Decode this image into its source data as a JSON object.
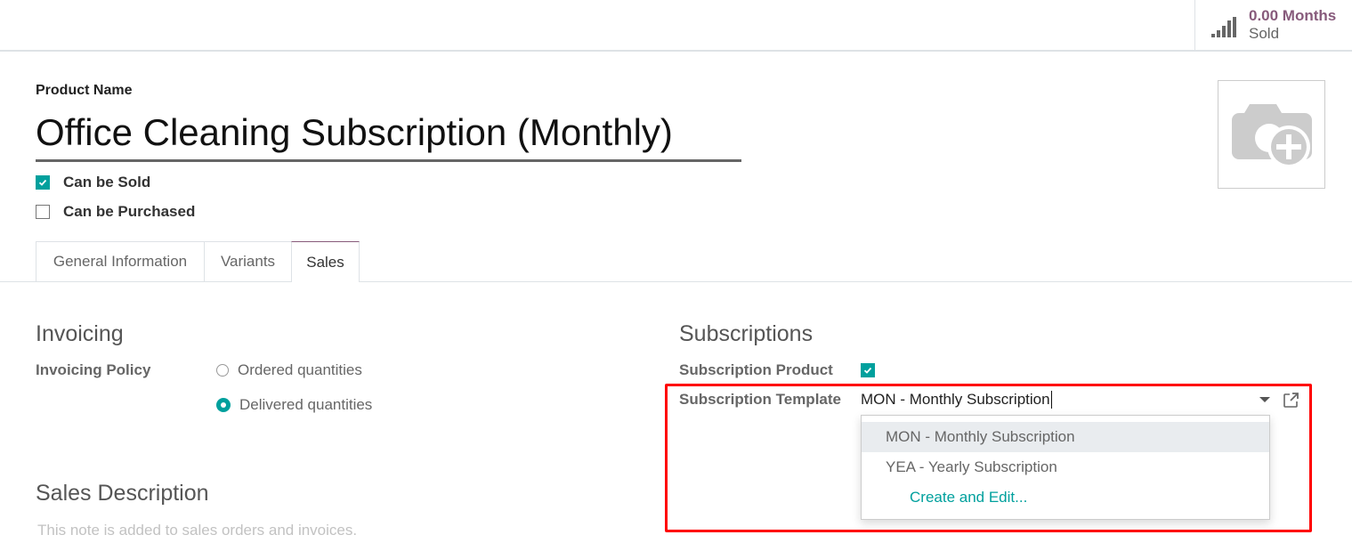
{
  "smart_button": {
    "value": "0.00 Months",
    "label": "Sold",
    "icon": "signal-bars-icon"
  },
  "product": {
    "name_label": "Product Name",
    "name": "Office Cleaning Subscription (Monthly)",
    "can_be_sold": {
      "label": "Can be Sold",
      "checked": true
    },
    "can_be_purchased": {
      "label": "Can be Purchased",
      "checked": false
    },
    "image_icon": "camera-plus-icon"
  },
  "tabs": [
    {
      "label": "General Information",
      "active": false
    },
    {
      "label": "Variants",
      "active": false
    },
    {
      "label": "Sales",
      "active": true
    }
  ],
  "invoicing": {
    "title": "Invoicing",
    "policy_label": "Invoicing Policy",
    "options": [
      {
        "label": "Ordered quantities",
        "selected": false
      },
      {
        "label": "Delivered quantities",
        "selected": true
      }
    ]
  },
  "subscriptions": {
    "title": "Subscriptions",
    "product_label": "Subscription Product",
    "product_checked": true,
    "template_label": "Subscription Template",
    "template_value": "MON - Monthly Subscription",
    "dropdown": [
      {
        "label": "MON - Monthly Subscription",
        "highlighted": true
      },
      {
        "label": "YEA - Yearly Subscription",
        "highlighted": false
      },
      {
        "label": "Create and Edit...",
        "highlighted": false
      }
    ],
    "highlight_color": "#ff0000"
  },
  "sales_description": {
    "title": "Sales Description",
    "placeholder": "This note is added to sales orders and invoices."
  },
  "colors": {
    "accent": "#00a09d",
    "brand": "#875a7b"
  }
}
